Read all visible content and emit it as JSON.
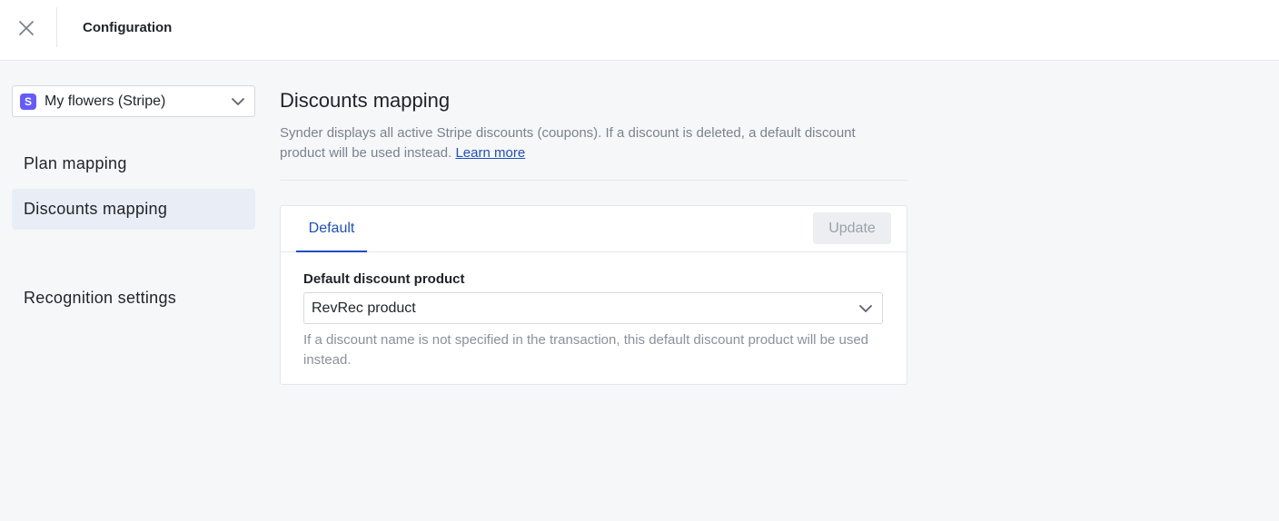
{
  "header": {
    "title": "Configuration",
    "close_icon": "close-icon"
  },
  "sidebar": {
    "account": {
      "badge": "S",
      "label": "My flowers (Stripe)",
      "badge_color": "#635bff"
    },
    "items": [
      {
        "label": "Plan mapping",
        "active": false
      },
      {
        "label": "Discounts mapping",
        "active": true
      },
      {
        "label": "Recognition settings",
        "active": false
      }
    ]
  },
  "main": {
    "title": "Discounts mapping",
    "description": "Synder displays all active Stripe discounts (coupons). If a discount is deleted, a default discount product will be used instead.",
    "learn_more": "Learn more",
    "card": {
      "tabs": [
        {
          "label": "Default",
          "active": true
        }
      ],
      "update_label": "Update",
      "field_label": "Default discount product",
      "field_value": "RevRec product",
      "field_hint": "If a discount name is not specified in the transaction, this default discount product will be used instead."
    }
  },
  "colors": {
    "accent": "#1d4fbf",
    "active_nav_bg": "#e8edf6",
    "page_bg": "#f6f7f9"
  }
}
